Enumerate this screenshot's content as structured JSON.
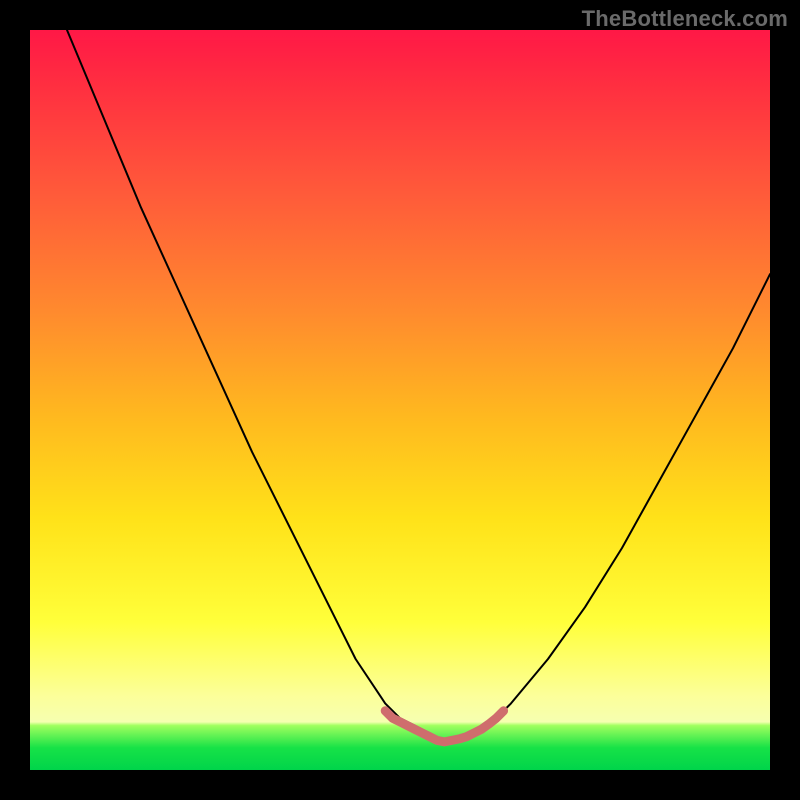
{
  "watermark": "TheBottleneck.com",
  "chart_data": {
    "type": "line",
    "title": "",
    "xlabel": "",
    "ylabel": "",
    "xlim": [
      0,
      100
    ],
    "ylim": [
      0,
      100
    ],
    "grid": false,
    "legend": false,
    "series": [
      {
        "name": "bottleneck-curve",
        "color": "#000000",
        "x": [
          5,
          10,
          15,
          20,
          25,
          30,
          35,
          40,
          44,
          48,
          50,
          52,
          55,
          58,
          62,
          65,
          70,
          75,
          80,
          85,
          90,
          95,
          100
        ],
        "values": [
          100,
          88,
          76,
          65,
          54,
          43,
          33,
          23,
          15,
          9,
          7,
          6,
          4,
          4,
          6,
          9,
          15,
          22,
          30,
          39,
          48,
          57,
          67
        ]
      },
      {
        "name": "optimal-marker",
        "color": "#d46a6a",
        "x": [
          48,
          49,
          50,
          51,
          52,
          53,
          54,
          55,
          56,
          57,
          58,
          59,
          60,
          61,
          62,
          63,
          64
        ],
        "values": [
          8,
          7,
          6.5,
          6,
          5.5,
          5,
          4.5,
          4,
          3.8,
          4,
          4.2,
          4.5,
          5,
          5.5,
          6.2,
          7,
          8
        ]
      }
    ],
    "gradient_stops": [
      {
        "pos": 0,
        "color": "#ff1846"
      },
      {
        "pos": 8,
        "color": "#ff3040"
      },
      {
        "pos": 22,
        "color": "#ff5a3a"
      },
      {
        "pos": 38,
        "color": "#ff8a2e"
      },
      {
        "pos": 52,
        "color": "#ffb81f"
      },
      {
        "pos": 66,
        "color": "#ffe219"
      },
      {
        "pos": 80,
        "color": "#ffff3a"
      },
      {
        "pos": 90,
        "color": "#fcff9a"
      },
      {
        "pos": 93.5,
        "color": "#f6ffb0"
      },
      {
        "pos": 94,
        "color": "#9fff5e"
      },
      {
        "pos": 97,
        "color": "#17e247"
      },
      {
        "pos": 100,
        "color": "#00d44a"
      }
    ]
  }
}
